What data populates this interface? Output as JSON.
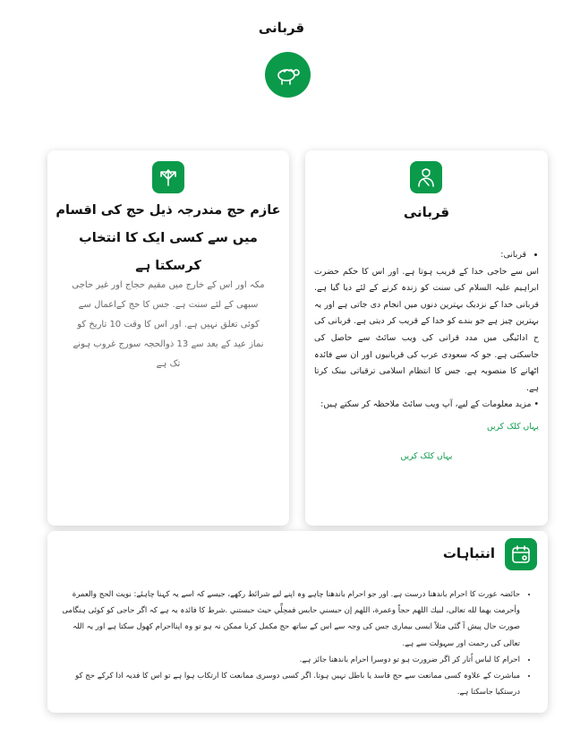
{
  "page": {
    "title": "قربانی"
  },
  "icons": {
    "hero": "sheep-icon",
    "left": "arrows-split-icon",
    "right": "pilgrim-icon",
    "bottom": "calendar-icon"
  },
  "colors": {
    "accent": "#0a9a4a",
    "link": "#0a9a4a"
  },
  "left_card": {
    "heading": "عازم حج مندرجہ ذیل حج کی اقسام میں سے کسی ایک کا انتخاب کرسکتا ہے",
    "body": "مکہ اور اس کے خارج میں مقیم حجاج اور غیر حاجی سبھی کے لئے سنت ہے. جس کا حج کےاعمال سے کوئی تعلق نہیں ہے. اور اس کا وقت 10 تاریخ کو نماز عید کے بعد سے 13 ذوالحجہ سورج غروب ہونے تک ہے"
  },
  "right_card": {
    "heading": "قربانی",
    "bullet_label": "قربانی:",
    "paragraph": "اس سے حاجی خدا کے قریب ہوتا ہے. اور اس کا حکم حضرت ابراہیم علیہ السلام کی سنت کو زندہ کرنے کے لئے دیا گیا ہے. قربانی خدا کے نزدیک بہترین دنوں میں انجام دی جاتی ہے اور یہ بہترین چیز ہے جو بندے کو خدا کے قریب کر دیتی ہے. قربانی کی ح ادائیگی میں مدد قرانی کی ویب سائٹ سے حاصل کی جاسکتی ہے. جو کہ سعودی عرب کی قربانیوں اور ان سے فائدہ اٹھانے کا منصوبہ ہے. جس کا انتظام اسلامی ترقیاتی بینک کرتا ہے.",
    "more_info": "• مزید معلومات کے لیے، آپ ویب سائٹ ملاحظہ کر سکتے ہیں:",
    "link1": "یہاں کلک کریں",
    "link2": "یہاں کلک کریں"
  },
  "bottom_card": {
    "heading": "انتباہات",
    "items": [
      "حائضہ عورت کا احرام باندھنا درست ہے. اور جو احرام باندھنا چاہے وہ اپنے لیے شرائط رکھے، جیسے کہ اسے یہ کہنا چاہئے: نویت الحج والعمرة وأحرمت بهما لله تعالى، لبيك اللهم حجاً وعمرة، اللهم إن حبسني حابس فمحِلِّي حيث حبستني .شرط کا فائدہ یہ ہے کہ اگر حاجی کو کوئی ہنگامی صورت حال پیش آ گئی مثلاً ایسی بیماری جس کی وجہ سے اس کے ساتھ حج مکمل کرنا ممکن نہ ہو تو وہ اپنااحرام کھول سکتا ہے اور یہ اللہ تعالی کی رحمت اور سہولت سے ہے.",
      "احرام کا لباس اُتار کر اگر ضرورت ہو تو دوسرا احرام باندھنا جائز ہے.",
      "مباشرت کے علاوہ کسی ممانعت سے حج فاسد یا باطل نہیں ہوتا. اگر کسی دوسری ممانعت کا ارتکاب ہوا ہے تو اس کا فدیہ ادا کرکے حج کو درستکیا جاسکتا ہے."
    ]
  }
}
